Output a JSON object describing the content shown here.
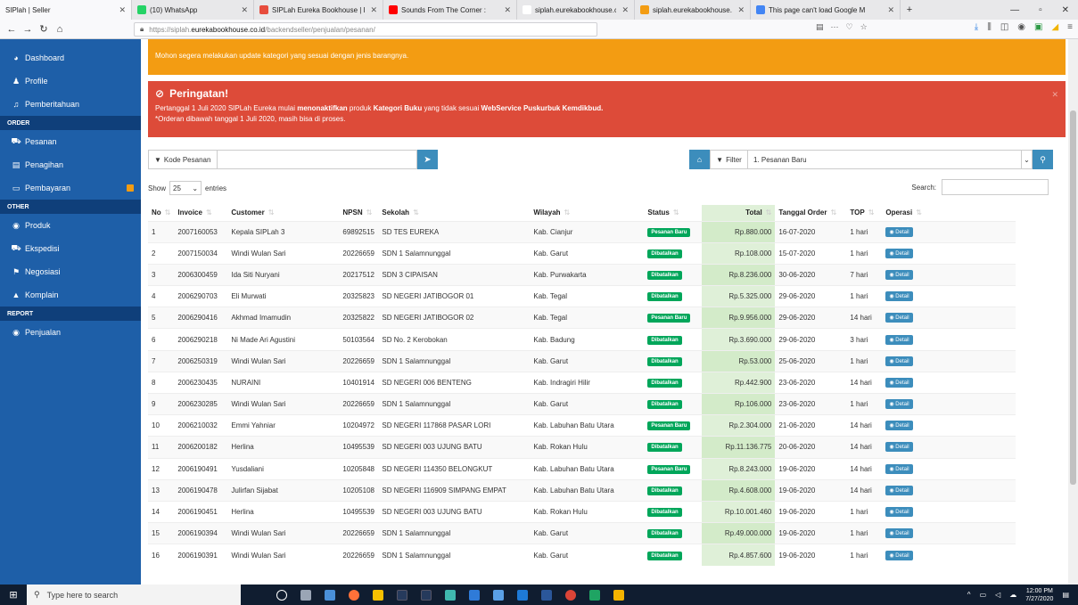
{
  "browser": {
    "tabs": [
      {
        "label": "SIPlah | Seller",
        "color": "#ffffff",
        "active": true
      },
      {
        "label": "(10) WhatsApp",
        "color": "#25d366",
        "active": false
      },
      {
        "label": "SIPLah Eureka Bookhouse | Bel",
        "color": "#e74c3c",
        "active": false
      },
      {
        "label": "Sounds From The Corner : ",
        "color": "#ff0000",
        "active": false
      },
      {
        "label": "siplah.eurekabookhouse.co.id/bac",
        "color": "#ffffff",
        "active": false
      },
      {
        "label": "siplah.eurekabookhouse.co.id",
        "color": "#f39c12",
        "active": false
      },
      {
        "label": "This page can't load Google M",
        "color": "#4285f4",
        "active": false
      }
    ],
    "url_prefix": "https://siplah.",
    "url_domain": "eurekabookhouse.co.id",
    "url_path": "/backendseller/penjualan/pesanan/"
  },
  "sidebar": {
    "items": [
      {
        "label": "Dashboard",
        "icon": "dashboard-icon",
        "glyph": "◕"
      },
      {
        "label": "Profile",
        "icon": "user-icon",
        "glyph": "♟"
      },
      {
        "label": "Pemberitahuan",
        "icon": "bell-icon",
        "glyph": "♫"
      }
    ],
    "section_order": "ORDER",
    "order_items": [
      {
        "label": "Pesanan",
        "icon": "cart-icon",
        "glyph": "⛟"
      },
      {
        "label": "Penagihan",
        "icon": "file-icon",
        "glyph": "▤"
      },
      {
        "label": "Pembayaran",
        "icon": "money-icon",
        "glyph": "▭"
      }
    ],
    "section_other": "OTHER",
    "other_items": [
      {
        "label": "Produk",
        "icon": "product-icon",
        "glyph": "◉"
      },
      {
        "label": "Ekspedisi",
        "icon": "truck-icon",
        "glyph": "⛟"
      },
      {
        "label": "Negosiasi",
        "icon": "flag-icon",
        "glyph": "⚑"
      },
      {
        "label": "Komplain",
        "icon": "warning-icon",
        "glyph": "▲"
      }
    ],
    "section_report": "REPORT",
    "report_items": [
      {
        "label": "Penjualan",
        "icon": "chart-icon",
        "glyph": "◉"
      }
    ]
  },
  "alerts": {
    "warning_line2": "Mohon segera melakukan update kategori yang sesuai dengan jenis barangnya.",
    "danger_title": "Peringatan!",
    "danger_line1_a": "Pertanggal 1 Juli 2020 SIPLah Eureka mulai ",
    "danger_line1_b": "menonaktifkan",
    "danger_line1_c": " produk ",
    "danger_line1_d": "Kategori Buku",
    "danger_line1_e": " yang tidak sesuai ",
    "danger_line1_f": "WebService Puskurbuk Kemdikbud.",
    "danger_line2": "*Orderan dibawah tanggal 1 Juli 2020, masih bisa di proses."
  },
  "filters": {
    "kode_label": "Kode Pesanan",
    "filter_label": "Filter",
    "filter_value": "1. Pesanan Baru"
  },
  "table_controls": {
    "show": "Show",
    "length": "25",
    "entries": "entries",
    "search": "Search:"
  },
  "columns": [
    "No",
    "Invoice",
    "Customer",
    "NPSN",
    "Sekolah",
    "Wilayah",
    "Status",
    "Total",
    "Tanggal Order",
    "TOP",
    "Operasi"
  ],
  "rows": [
    {
      "no": "1",
      "invoice": "2007160053",
      "customer": "Kepala SIPLah 3",
      "npsn": "69892515",
      "sekolah": "SD TES EUREKA",
      "wilayah": "Kab. Cianjur",
      "status": "Pesanan Baru",
      "total": "Rp.880.000",
      "tanggal": "16-07-2020",
      "top": "1 hari"
    },
    {
      "no": "2",
      "invoice": "2007150034",
      "customer": "Windi Wulan Sari",
      "npsn": "20226659",
      "sekolah": "SDN 1 Salamnunggal",
      "wilayah": "Kab. Garut",
      "status": "Dibatalkan",
      "total": "Rp.108.000",
      "tanggal": "15-07-2020",
      "top": "1 hari"
    },
    {
      "no": "3",
      "invoice": "2006300459",
      "customer": "Ida Siti Nuryani",
      "npsn": "20217512",
      "sekolah": "SDN 3 CIPAISAN",
      "wilayah": "Kab. Purwakarta",
      "status": "Dibatalkan",
      "total": "Rp.8.236.000",
      "tanggal": "30-06-2020",
      "top": "7 hari"
    },
    {
      "no": "4",
      "invoice": "2006290703",
      "customer": "Eli Murwati",
      "npsn": "20325823",
      "sekolah": "SD NEGERI JATIBOGOR 01",
      "wilayah": "Kab. Tegal",
      "status": "Dibatalkan",
      "total": "Rp.5.325.000",
      "tanggal": "29-06-2020",
      "top": "1 hari"
    },
    {
      "no": "5",
      "invoice": "2006290416",
      "customer": "Akhmad Imamudin",
      "npsn": "20325822",
      "sekolah": "SD NEGERI JATIBOGOR 02",
      "wilayah": "Kab. Tegal",
      "status": "Pesanan Baru",
      "total": "Rp.9.956.000",
      "tanggal": "29-06-2020",
      "top": "14 hari"
    },
    {
      "no": "6",
      "invoice": "2006290218",
      "customer": "Ni Made Ari Agustini",
      "npsn": "50103564",
      "sekolah": "SD No. 2 Kerobokan",
      "wilayah": "Kab. Badung",
      "status": "Dibatalkan",
      "total": "Rp.3.690.000",
      "tanggal": "29-06-2020",
      "top": "3 hari"
    },
    {
      "no": "7",
      "invoice": "2006250319",
      "customer": "Windi Wulan Sari",
      "npsn": "20226659",
      "sekolah": "SDN 1 Salamnunggal",
      "wilayah": "Kab. Garut",
      "status": "Dibatalkan",
      "total": "Rp.53.000",
      "tanggal": "25-06-2020",
      "top": "1 hari"
    },
    {
      "no": "8",
      "invoice": "2006230435",
      "customer": "NURAINI",
      "npsn": "10401914",
      "sekolah": "SD NEGERI 006 BENTENG",
      "wilayah": "Kab. Indragiri Hilir",
      "status": "Dibatalkan",
      "total": "Rp.442.900",
      "tanggal": "23-06-2020",
      "top": "14 hari"
    },
    {
      "no": "9",
      "invoice": "2006230285",
      "customer": "Windi Wulan Sari",
      "npsn": "20226659",
      "sekolah": "SDN 1 Salamnunggal",
      "wilayah": "Kab. Garut",
      "status": "Dibatalkan",
      "total": "Rp.106.000",
      "tanggal": "23-06-2020",
      "top": "1 hari"
    },
    {
      "no": "10",
      "invoice": "2006210032",
      "customer": "Emmi Yahniar",
      "npsn": "10204972",
      "sekolah": "SD NEGERI 117868 PASAR LORI",
      "wilayah": "Kab. Labuhan Batu Utara",
      "status": "Pesanan Baru",
      "total": "Rp.2.304.000",
      "tanggal": "21-06-2020",
      "top": "14 hari"
    },
    {
      "no": "11",
      "invoice": "2006200182",
      "customer": "Herlina",
      "npsn": "10495539",
      "sekolah": "SD NEGERI 003 UJUNG BATU",
      "wilayah": "Kab. Rokan Hulu",
      "status": "Dibatalkan",
      "total": "Rp.11.136.775",
      "tanggal": "20-06-2020",
      "top": "14 hari"
    },
    {
      "no": "12",
      "invoice": "2006190491",
      "customer": "Yusdaliani",
      "npsn": "10205848",
      "sekolah": "SD NEGERI 114350 BELONGKUT",
      "wilayah": "Kab. Labuhan Batu Utara",
      "status": "Pesanan Baru",
      "total": "Rp.8.243.000",
      "tanggal": "19-06-2020",
      "top": "14 hari"
    },
    {
      "no": "13",
      "invoice": "2006190478",
      "customer": "Julirfan Sijabat",
      "npsn": "10205108",
      "sekolah": "SD NEGERI 116909 SIMPANG EMPAT",
      "wilayah": "Kab. Labuhan Batu Utara",
      "status": "Dibatalkan",
      "total": "Rp.4.608.000",
      "tanggal": "19-06-2020",
      "top": "14 hari"
    },
    {
      "no": "14",
      "invoice": "2006190451",
      "customer": "Herlina",
      "npsn": "10495539",
      "sekolah": "SD NEGERI 003 UJUNG BATU",
      "wilayah": "Kab. Rokan Hulu",
      "status": "Dibatalkan",
      "total": "Rp.10.001.460",
      "tanggal": "19-06-2020",
      "top": "1 hari"
    },
    {
      "no": "15",
      "invoice": "2006190394",
      "customer": "Windi Wulan Sari",
      "npsn": "20226659",
      "sekolah": "SDN 1 Salamnunggal",
      "wilayah": "Kab. Garut",
      "status": "Dibatalkan",
      "total": "Rp.49.000.000",
      "tanggal": "19-06-2020",
      "top": "1 hari"
    },
    {
      "no": "16",
      "invoice": "2006190391",
      "customer": "Windi Wulan Sari",
      "npsn": "20226659",
      "sekolah": "SDN 1 Salamnunggal",
      "wilayah": "Kab. Garut",
      "status": "Dibatalkan",
      "total": "Rp.4.857.600",
      "tanggal": "19-06-2020",
      "top": "1 hari"
    }
  ],
  "detail_label": "Detail",
  "taskbar": {
    "search_placeholder": "Type here to search",
    "time": "12:00 PM",
    "date": "7/27/2020"
  },
  "colors": {
    "sidebar": "#1e5fa8",
    "warning": "#f39c12",
    "danger": "#dd4b39",
    "primary": "#3c8dbc",
    "success": "#00a65a"
  }
}
